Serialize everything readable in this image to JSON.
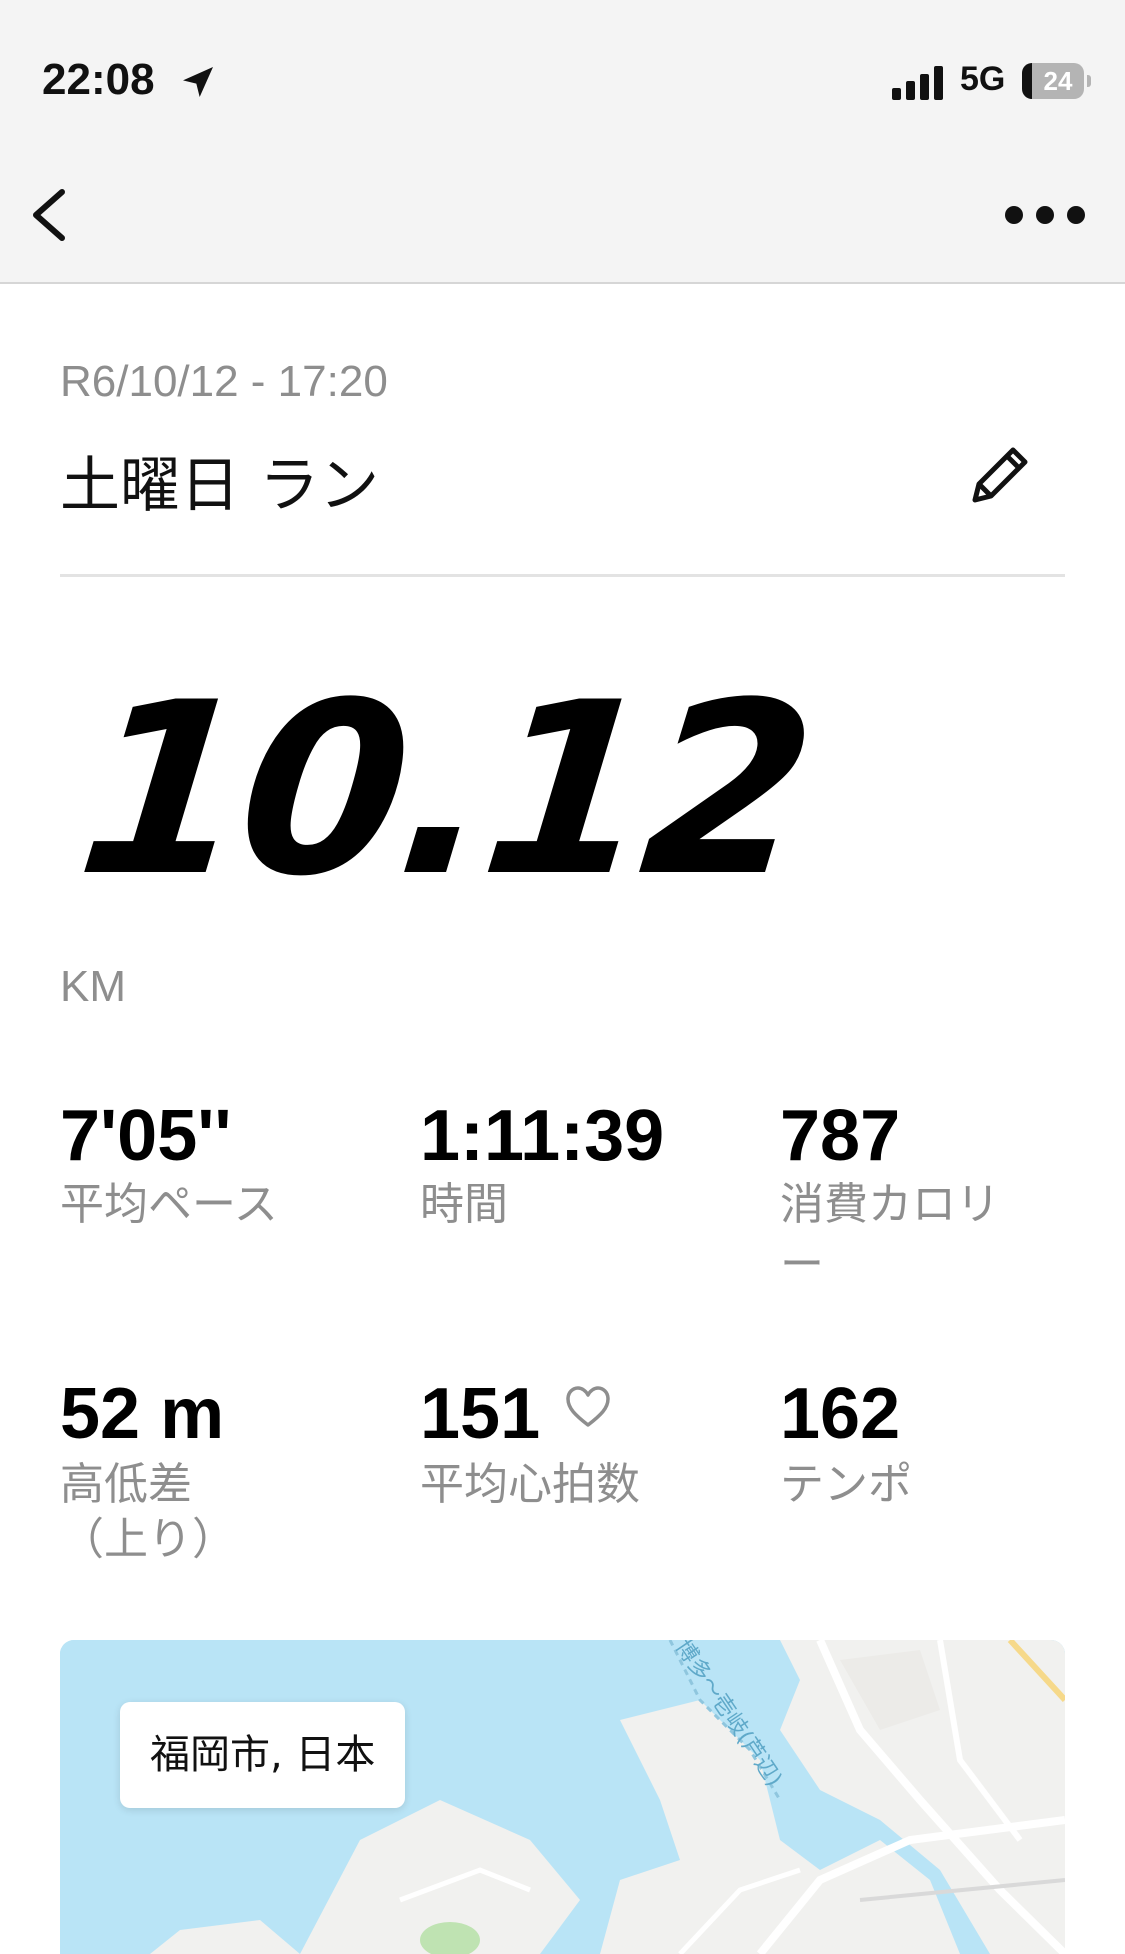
{
  "status_bar": {
    "time": "22:08",
    "network": "5G",
    "battery": "24"
  },
  "activity": {
    "date": "R6/10/12 - 17:20",
    "title": "土曜日 ラン",
    "distance": "10.12",
    "unit": "KM"
  },
  "stats": [
    {
      "value": "7'05''",
      "label": "平均ペース"
    },
    {
      "value": "1:11:39",
      "label": "時間"
    },
    {
      "value": "787",
      "label": "消費カロリ",
      "label2": "ー"
    },
    {
      "value": "52 m",
      "label": "高低差",
      "label2": "（上り）"
    },
    {
      "value": "151",
      "label": "平均心拍数"
    },
    {
      "value": "162",
      "label": "テンポ"
    }
  ],
  "map": {
    "location": "福岡市, 日本",
    "ferry_label": "博多～壱岐(芦辺)"
  }
}
